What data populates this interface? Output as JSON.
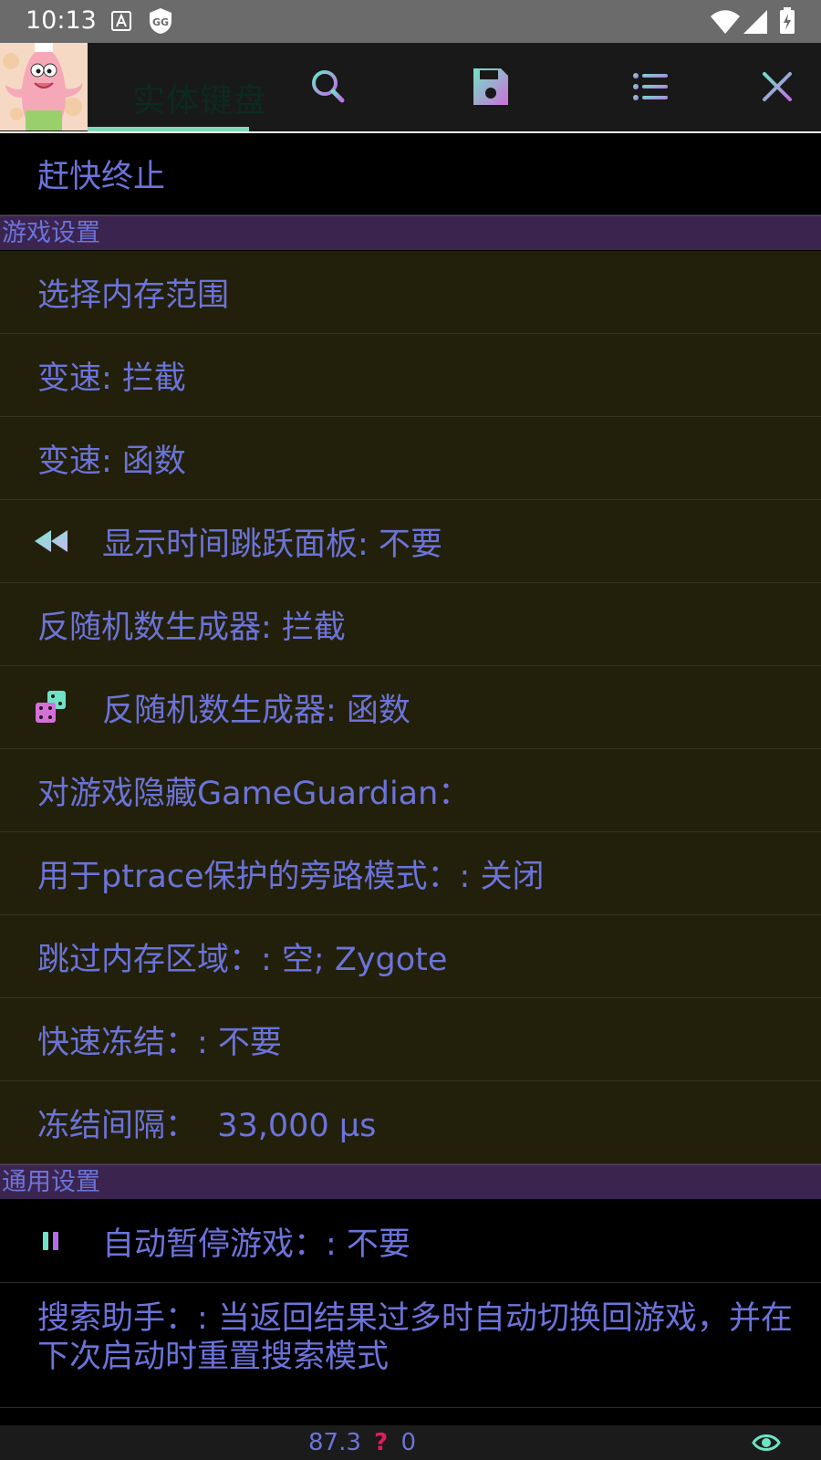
{
  "status_bar": {
    "time": "10:13",
    "icons": [
      "keyboard-a-icon",
      "gg-shield-icon",
      "wifi-icon",
      "cell-signal-icon",
      "battery-charging-icon"
    ]
  },
  "toolbar": {
    "avatar": "patrick-avatar",
    "ghost_tab_label": "实体键盘",
    "buttons": [
      "sliders-icon",
      "search-icon",
      "save-icon",
      "list-icon",
      "close-icon"
    ]
  },
  "list": {
    "top_item": "赶快终止",
    "sections": [
      {
        "title": "游戏设置",
        "items": [
          {
            "label": "选择内存范围"
          },
          {
            "label": "变速: 拦截"
          },
          {
            "label": "变速: 函数"
          },
          {
            "label": "显示时间跳跃面板: 不要",
            "icon": "rewind-icon"
          },
          {
            "label": "反随机数生成器: 拦截"
          },
          {
            "label": "反随机数生成器: 函数",
            "icon": "dice-icon"
          },
          {
            "label": "对游戏隐藏GameGuardian："
          },
          {
            "label": "用于ptrace保护的旁路模式：: 关闭"
          },
          {
            "label": "跳过内存区域：: 空; Zygote"
          },
          {
            "label": "快速冻结：: 不要"
          },
          {
            "label": "冻结间隔：  33,000 µs"
          }
        ]
      },
      {
        "title": "通用设置",
        "items": [
          {
            "label": "自动暂停游戏：: 不要",
            "icon": "pause-icon"
          },
          {
            "label_line1": "搜索助手：: 当返回结果过多时自动切换回游戏，并在",
            "label_line2": "下次启动时重置搜索模式"
          }
        ]
      }
    ]
  },
  "bottom_bar": {
    "value": "87.3",
    "unknown": "?",
    "count": "0",
    "icon": "eye-icon"
  },
  "colors": {
    "text": "#6c73d9",
    "section_bg": "#3b254f",
    "row_bg": "#22200a",
    "accent": "#7fd7b5"
  }
}
